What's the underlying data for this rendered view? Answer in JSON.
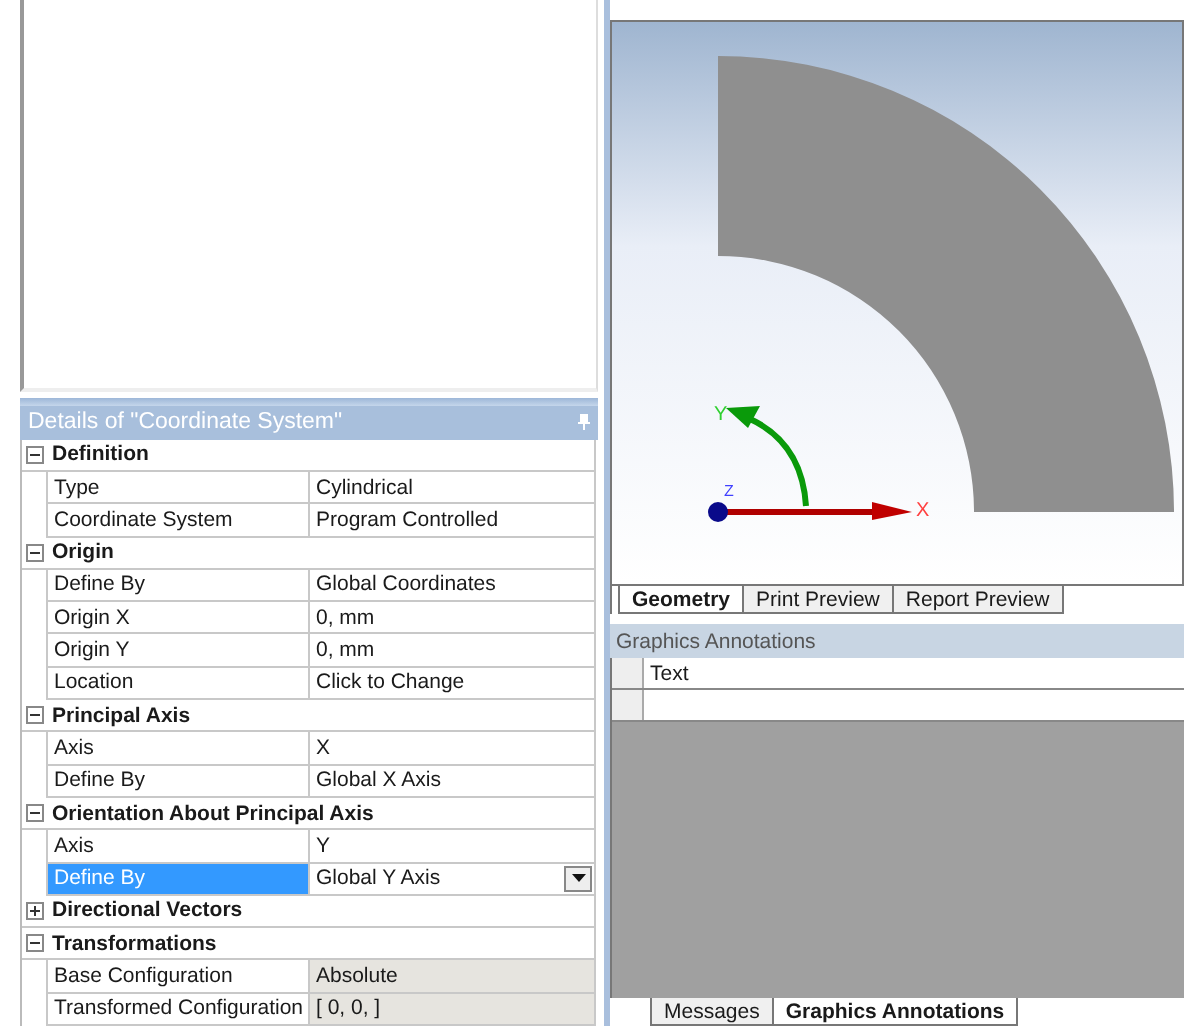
{
  "details": {
    "title": "Details of \"Coordinate System\"",
    "sections": [
      {
        "title": "Definition",
        "expanded": true,
        "rows": [
          {
            "name": "Type",
            "value": "Cylindrical",
            "selected": false,
            "readonly": false
          },
          {
            "name": "Coordinate System",
            "value": "Program Controlled",
            "selected": false,
            "readonly": false
          }
        ]
      },
      {
        "title": "Origin",
        "expanded": true,
        "rows": [
          {
            "name": "Define By",
            "value": "Global Coordinates",
            "selected": false,
            "readonly": false
          },
          {
            "name": "Origin X",
            "value": "0, mm",
            "selected": false,
            "readonly": false
          },
          {
            "name": "Origin Y",
            "value": "0, mm",
            "selected": false,
            "readonly": false
          },
          {
            "name": "Location",
            "value": "Click to Change",
            "selected": false,
            "readonly": false
          }
        ]
      },
      {
        "title": "Principal Axis",
        "expanded": true,
        "rows": [
          {
            "name": "Axis",
            "value": "X",
            "selected": false,
            "readonly": false
          },
          {
            "name": "Define By",
            "value": "Global X Axis",
            "selected": false,
            "readonly": false
          }
        ]
      },
      {
        "title": "Orientation About Principal Axis",
        "expanded": true,
        "rows": [
          {
            "name": "Axis",
            "value": "Y",
            "selected": false,
            "readonly": false
          },
          {
            "name": "Define By",
            "value": "Global Y Axis",
            "selected": true,
            "readonly": false,
            "kind": "dropdown"
          }
        ]
      },
      {
        "title": "Directional Vectors",
        "expanded": false
      },
      {
        "title": "Transformations",
        "expanded": true,
        "rows": [
          {
            "name": "Base Configuration",
            "value": "Absolute",
            "selected": false,
            "readonly": true
          },
          {
            "name": "Transformed Configuration",
            "value": "[ 0,  0, ]",
            "selected": false,
            "readonly": true
          }
        ]
      }
    ]
  },
  "viewport": {
    "axes": {
      "x": "X",
      "y": "Y",
      "z": "Z"
    },
    "tabs": [
      {
        "label": "Geometry",
        "selected": true
      },
      {
        "label": "Print Preview",
        "selected": false
      },
      {
        "label": "Report Preview",
        "selected": false
      }
    ]
  },
  "annotations": {
    "title": "Graphics Annotations",
    "columns": [
      "Text"
    ],
    "tabs": [
      {
        "label": "Messages",
        "selected": false
      },
      {
        "label": "Graphics Annotations",
        "selected": true
      }
    ]
  }
}
